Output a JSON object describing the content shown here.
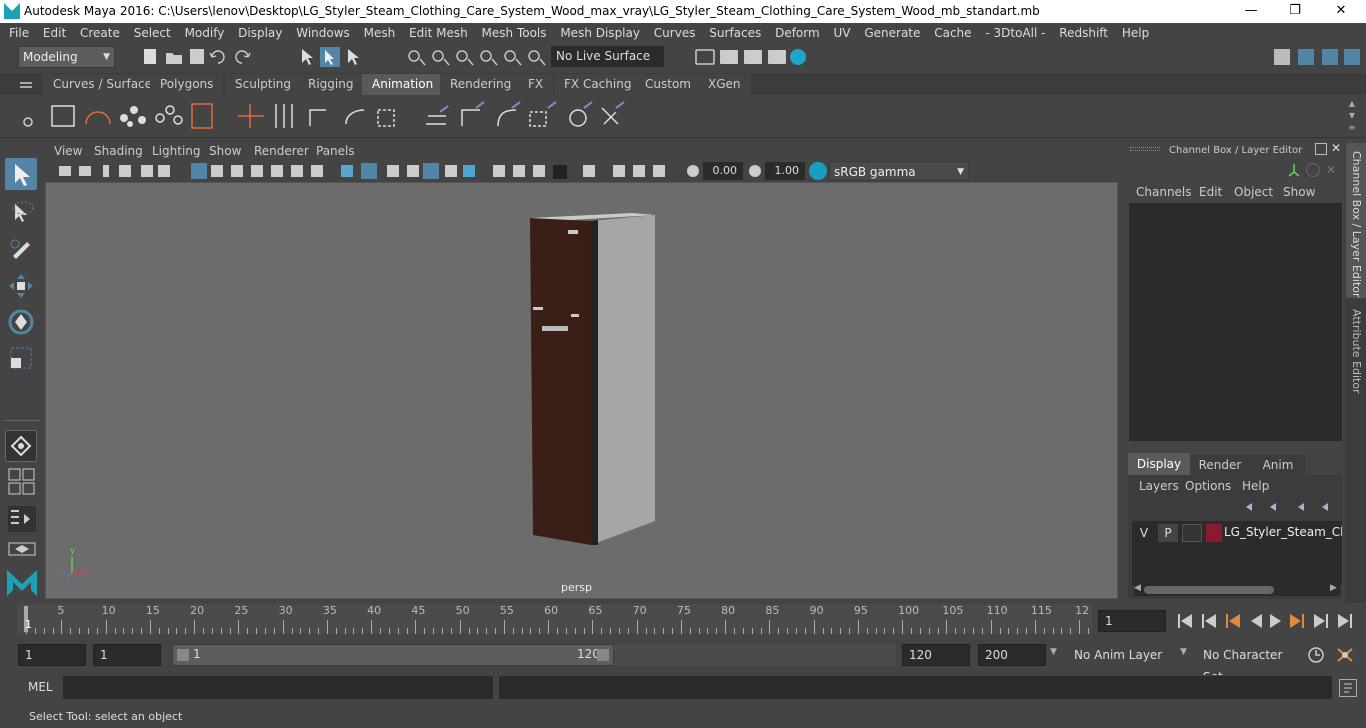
{
  "window": {
    "title": "Autodesk Maya 2016: C:\\Users\\lenov\\Desktop\\LG_Styler_Steam_Clothing_Care_System_Wood_max_vray\\LG_Styler_Steam_Clothing_Care_System_Wood_mb_standart.mb",
    "minimize": "—",
    "restore": "❐",
    "close": "✕"
  },
  "menubar": [
    "File",
    "Edit",
    "Create",
    "Select",
    "Modify",
    "Display",
    "Windows",
    "Mesh",
    "Edit Mesh",
    "Mesh Tools",
    "Mesh Display",
    "Curves",
    "Surfaces",
    "Deform",
    "UV",
    "Generate",
    "Cache",
    "- 3DtoAll -",
    "Redshift",
    "Help"
  ],
  "statusline": {
    "mode": "Modeling",
    "live_surface": "No Live Surface"
  },
  "shelf": {
    "tabs": [
      "Curves / Surfaces",
      "Polygons",
      "Sculpting",
      "Rigging",
      "Animation",
      "Rendering",
      "FX",
      "FX Caching",
      "Custom",
      "XGen"
    ],
    "active_tab": "Animation"
  },
  "viewport": {
    "menus": [
      "View",
      "Shading",
      "Lighting",
      "Show",
      "Renderer",
      "Panels"
    ],
    "exposure": "0.00",
    "gamma": "1.00",
    "color_space": "sRGB gamma",
    "camera_label": "persp",
    "axis_y": "y",
    "axis_x": "x",
    "axis_z": "z"
  },
  "channel_box": {
    "title": "Channel Box / Layer Editor",
    "menus": [
      "Channels",
      "Edit",
      "Object",
      "Show"
    ]
  },
  "layer_editor": {
    "tabs": [
      "Display",
      "Render",
      "Anim"
    ],
    "active_tab": "Display",
    "menus": [
      "Layers",
      "Options",
      "Help"
    ],
    "layer": {
      "v": "V",
      "p": "P",
      "name": "LG_Styler_Steam_Cloth",
      "color": "#8b1a2e"
    }
  },
  "side_tabs": [
    "Channel Box / Layer Editor",
    "Attribute Editor"
  ],
  "timeline": {
    "ticks": [
      "5",
      "10",
      "15",
      "20",
      "25",
      "30",
      "35",
      "40",
      "45",
      "50",
      "55",
      "60",
      "65",
      "70",
      "75",
      "80",
      "85",
      "90",
      "95",
      "100",
      "105",
      "110",
      "115",
      "12"
    ],
    "current_frame_marker": "1",
    "current_frame": "1"
  },
  "range": {
    "start": "1",
    "playback_start": "1",
    "slider_start": "1",
    "slider_end": "120",
    "playback_end": "120",
    "end": "200",
    "anim_layer": "No Anim Layer",
    "character_set": "No Character Set"
  },
  "commandline": {
    "label": "MEL"
  },
  "helpline": {
    "text": "Select Tool: select an object"
  },
  "colors": {
    "accent": "#5285a6",
    "door_wood": "#3a1e16",
    "body_gray": "#a7a7a7"
  }
}
